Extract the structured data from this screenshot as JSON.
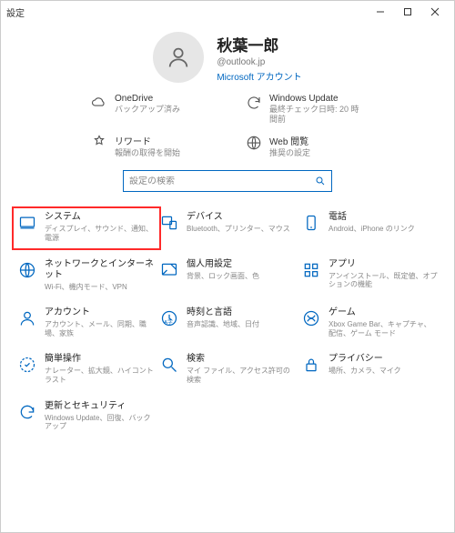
{
  "titlebar": {
    "title": "設定"
  },
  "user": {
    "name": "秋葉一郎",
    "email": "@outlook.jp",
    "ms_account": "Microsoft アカウント"
  },
  "tiles": [
    {
      "icon": "cloud",
      "title": "OneDrive",
      "sub": "バックアップ済み"
    },
    {
      "icon": "sync",
      "title": "Windows Update",
      "sub": "最終チェック日時: 20 時間前"
    },
    {
      "icon": "rewards",
      "title": "リワード",
      "sub": "報酬の取得を開始"
    },
    {
      "icon": "globe",
      "title": "Web 閲覧",
      "sub": "推奨の設定"
    }
  ],
  "search": {
    "placeholder": "設定の検索"
  },
  "categories": [
    {
      "icon": "system",
      "title": "システム",
      "sub": "ディスプレイ、サウンド、通知、電源",
      "highlight": true
    },
    {
      "icon": "devices",
      "title": "デバイス",
      "sub": "Bluetooth、プリンター、マウス"
    },
    {
      "icon": "phone",
      "title": "電話",
      "sub": "Android、iPhone のリンク"
    },
    {
      "icon": "network",
      "title": "ネットワークとインターネット",
      "sub": "Wi-Fi、機内モード、VPN"
    },
    {
      "icon": "personalize",
      "title": "個人用設定",
      "sub": "背景、ロック画面、色"
    },
    {
      "icon": "apps",
      "title": "アプリ",
      "sub": "アンインストール、既定値、オプションの機能"
    },
    {
      "icon": "account",
      "title": "アカウント",
      "sub": "アカウント、メール、同期、職場、家族"
    },
    {
      "icon": "time",
      "title": "時刻と言語",
      "sub": "音声認識、地域、日付"
    },
    {
      "icon": "gaming",
      "title": "ゲーム",
      "sub": "Xbox Game Bar、キャプチャ、配信、ゲーム モード"
    },
    {
      "icon": "ease",
      "title": "簡単操作",
      "sub": "ナレーター、拡大鏡、ハイコントラスト"
    },
    {
      "icon": "search",
      "title": "検索",
      "sub": "マイ ファイル、アクセス許可の検索"
    },
    {
      "icon": "privacy",
      "title": "プライバシー",
      "sub": "場所、カメラ、マイク"
    },
    {
      "icon": "update",
      "title": "更新とセキュリティ",
      "sub": "Windows Update、回復、バックアップ"
    }
  ]
}
